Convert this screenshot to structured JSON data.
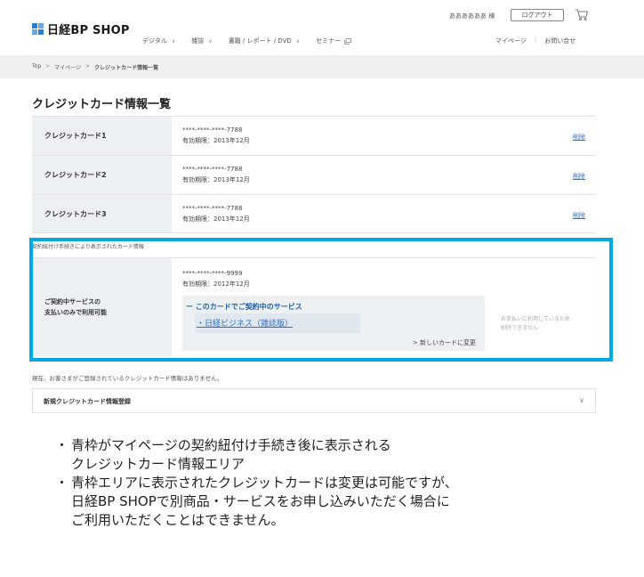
{
  "header": {
    "logo_text": "日経BP SHOP",
    "user_name": "ああああああ 様",
    "logout_label": "ログアウト",
    "nav": [
      {
        "label": "デジタル"
      },
      {
        "label": "雑誌"
      },
      {
        "label": "書籍 / レポート / DVD"
      },
      {
        "label": "セミナー"
      }
    ],
    "util_nav": {
      "mypage": "マイページ",
      "separator": "|",
      "contact": "お問い合せ"
    }
  },
  "breadcrumb": {
    "items": [
      "Top",
      "マイページ",
      "クレジットカード情報一覧"
    ],
    "separator": ">"
  },
  "page_title": "クレジットカード情報一覧",
  "cards": [
    {
      "label": "クレジットカード1",
      "number": "****-****-****-7788",
      "expiry": "有効期限：2013年12月",
      "delete": "削除"
    },
    {
      "label": "クレジットカード2",
      "number": "****-****-****-7788",
      "expiry": "有効期限：2013年12月",
      "delete": "削除"
    },
    {
      "label": "クレジットカード3",
      "number": "****-****-****-7788",
      "expiry": "有効期限：2013年12月",
      "delete": "削除"
    }
  ],
  "linked": {
    "note": "契約紐付け手続きにより表示されたカード情報",
    "label_line1": "ご契約中サービスの",
    "label_line2": "支払いのみで利用可能",
    "number": "****-****-****-9999",
    "expiry": "有効期限：2012年12月",
    "service_title": "ー このカードでご契約中のサービス",
    "service_link": "・日経ビジネス（雑誌版）",
    "change_card": "> 新しいカードに変更",
    "disabled_note_line1": "お支払いに利用しているため",
    "disabled_note_line2": "削除できません"
  },
  "no_cards_msg": "現在、お客さまがご登録されているクレジットカード情報はありません。",
  "new_card_label": "新規クレジットカード情報登録",
  "annotations": [
    {
      "bullet": "・",
      "lines": [
        "青枠がマイページの契約紐付け手続き後に表示される",
        "クレジットカード情報エリア"
      ]
    },
    {
      "bullet": "・",
      "lines": [
        "青枠エリアに表示されたクレジットカードは変更は可能ですが、",
        "日経BP SHOPで別商品・サービスをお申し込みいただく場合に",
        "ご利用いただくことはできません。"
      ]
    }
  ],
  "colors": {
    "highlight": "#00a9e2",
    "link": "#2a73c4",
    "logo": "#2a7fd2"
  }
}
